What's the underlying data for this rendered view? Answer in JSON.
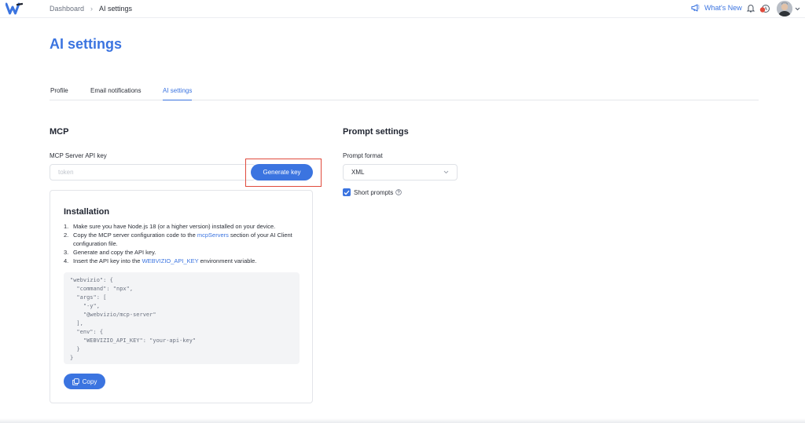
{
  "header": {
    "breadcrumb": [
      "Dashboard",
      "AI settings"
    ],
    "whats_new_label": "What's New",
    "colors": {
      "accent": "#3b74e0",
      "notification": "#e04a3c"
    }
  },
  "page": {
    "title": "AI settings"
  },
  "tabs": [
    {
      "label": "Profile",
      "active": false
    },
    {
      "label": "Email notifications",
      "active": false
    },
    {
      "label": "AI settings",
      "active": true
    }
  ],
  "mcp": {
    "section_title": "MCP",
    "api_key_label": "MCP Server API key",
    "api_key_placeholder": "token",
    "api_key_value": "",
    "generate_button": "Generate key"
  },
  "installation": {
    "title": "Installation",
    "steps": [
      {
        "num": "1.",
        "text": "Make sure you have Node.js 18 (or a higher version) installed on your device."
      },
      {
        "num": "2.",
        "text_before": "Copy the MCP server configuration code to the ",
        "link": "mcpServers",
        "text_after": " section of your AI Client configuration file."
      },
      {
        "num": "3.",
        "text": "Generate and copy the API key."
      },
      {
        "num": "4.",
        "text_before": "Insert the API key into the ",
        "link": "WEBVIZIO_API_KEY",
        "text_after": " environment variable."
      }
    ],
    "code": "\"webvizio\": {\n  \"command\": \"npx\",\n  \"args\": [\n    \"-y\",\n    \"@webvizio/mcp-server\"\n  ],\n  \"env\": {\n    \"WEBVIZIO_API_KEY\": \"your-api-key\"\n  }\n}",
    "copy_button": "Copy"
  },
  "prompt": {
    "section_title": "Prompt settings",
    "format_label": "Prompt format",
    "format_value": "XML",
    "short_prompts_label": "Short prompts",
    "short_prompts_checked": true
  }
}
